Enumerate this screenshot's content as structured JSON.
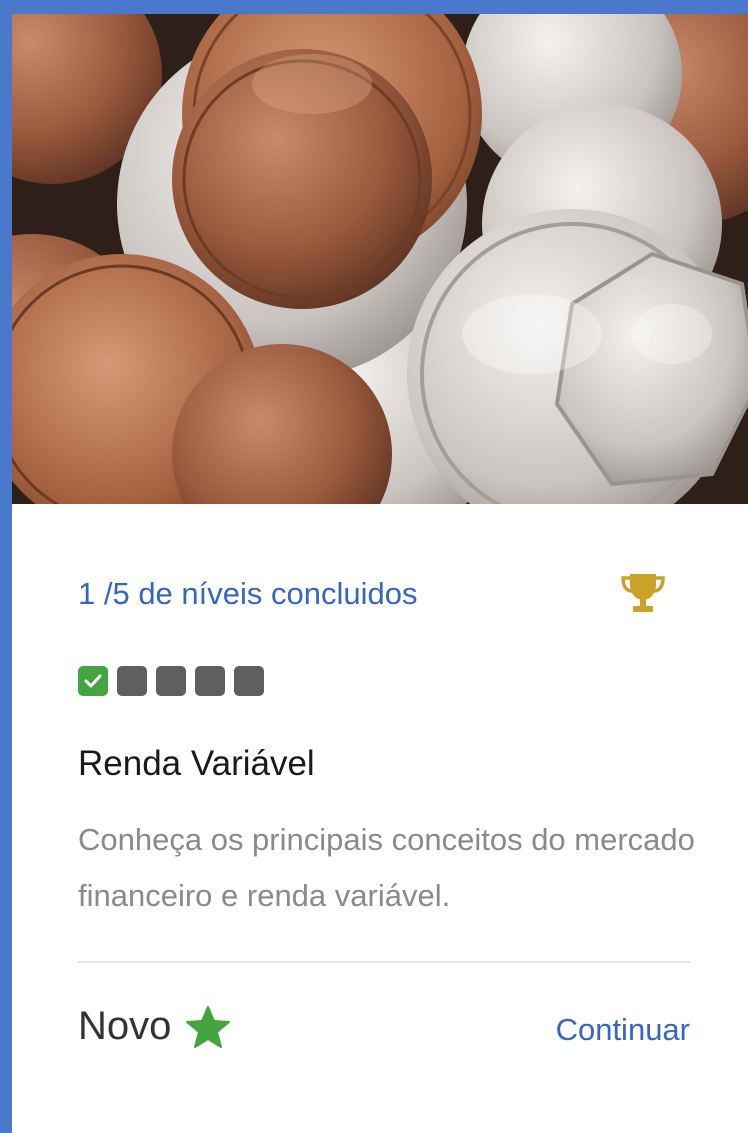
{
  "card": {
    "image_alt": "coins-photo",
    "progress_text": "1 /5 de níveis concluidos",
    "levels": [
      {
        "state": "completed"
      },
      {
        "state": "pending"
      },
      {
        "state": "pending"
      },
      {
        "state": "pending"
      },
      {
        "state": "pending"
      }
    ],
    "title": "Renda Variável",
    "description": "Conheça os principais conceitos do mercado financeiro e renda variável.",
    "status_label": "Novo",
    "continue_label": "Continuar"
  },
  "icons": {
    "trophy": "trophy-icon",
    "check": "check-icon",
    "star": "star-icon"
  },
  "colors": {
    "accent_border": "#4a78cc",
    "link": "#3566c2",
    "trophy": "#c9a227",
    "level_done": "#43a440",
    "level_pending": "#5f5f5f",
    "star": "#43a440"
  }
}
